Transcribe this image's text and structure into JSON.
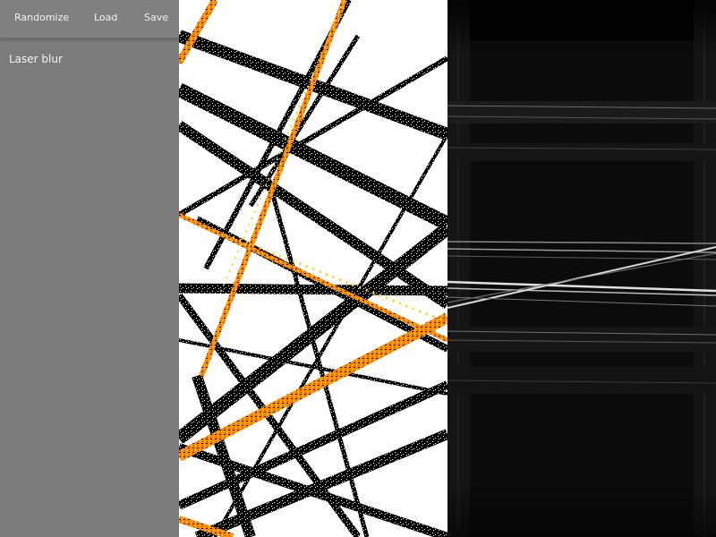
{
  "toolbar": {
    "randomize_label": "Randomize",
    "load_label": "Load",
    "save_label": "Save"
  },
  "sidebar": {
    "filter_label": "Laser blur"
  },
  "colors": {
    "sidebar_bg": "#7b7b7b",
    "toolbar_bg": "#808080",
    "stroke_dark": "#000000",
    "stroke_accent": "#ff8c00",
    "stroke_highlight": "#ffd21a",
    "result_bg": "#0b0b0b"
  }
}
